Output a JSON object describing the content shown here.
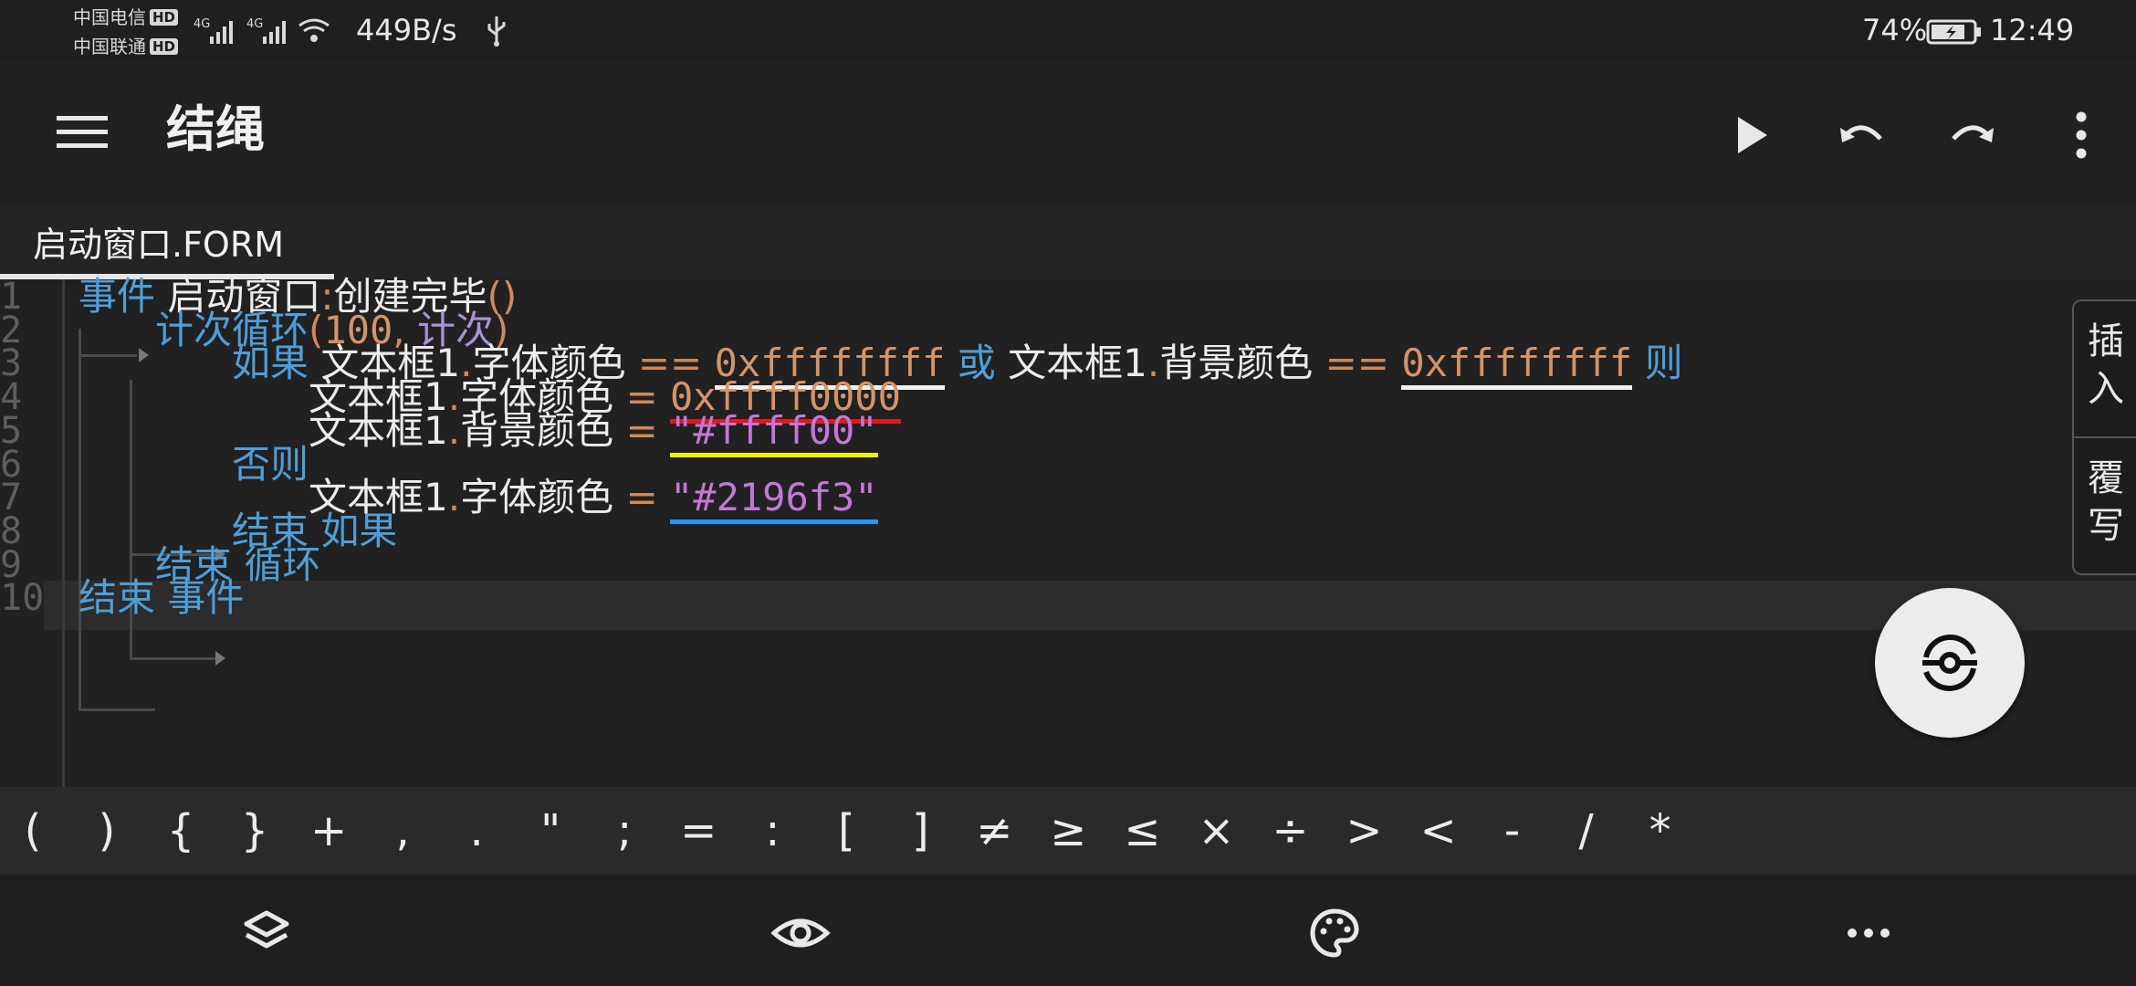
{
  "status_bar": {
    "carrier1": "中国电信",
    "carrier2": "中国联通",
    "hd": "HD",
    "net_type": "4G",
    "net_speed": "449B/s",
    "battery": "74%",
    "time": "12:49"
  },
  "app_bar": {
    "title": "结绳",
    "actions": [
      "menu-icon",
      "play-icon",
      "undo-icon",
      "redo-icon",
      "more-vert-icon"
    ]
  },
  "tabs": [
    {
      "label": "启动窗口.FORM",
      "active": true
    }
  ],
  "editor": {
    "current_line": 7,
    "lines": [
      {
        "num": "1",
        "tokens": [
          {
            "t": "事件",
            "c": "kw"
          },
          {
            "t": " 启动窗口",
            "c": "id"
          },
          {
            "t": ":",
            "c": "op"
          },
          {
            "t": "创建完毕",
            "c": "id"
          },
          {
            "t": "()",
            "c": "op"
          }
        ]
      },
      {
        "num": "2",
        "tokens": [
          {
            "t": "计次循环",
            "c": "kw"
          },
          {
            "t": "(",
            "c": "op"
          },
          {
            "t": "100",
            "c": "num"
          },
          {
            "t": ", ",
            "c": "op"
          },
          {
            "t": "计次",
            "c": "call"
          },
          {
            "t": ")",
            "c": "op"
          }
        ]
      },
      {
        "num": "3",
        "tokens": [
          {
            "t": "如果",
            "c": "kw"
          },
          {
            "t": " 文本框1",
            "c": "id"
          },
          {
            "t": ".",
            "c": "op"
          },
          {
            "t": "字体颜色",
            "c": "id"
          },
          {
            "t": " == ",
            "c": "op"
          },
          {
            "t": "0xffffffff",
            "c": "num",
            "u": "#f0f0f0"
          },
          {
            "t": " 或",
            "c": "kw"
          },
          {
            "t": " 文本框1",
            "c": "id"
          },
          {
            "t": ".",
            "c": "op"
          },
          {
            "t": "背景颜色",
            "c": "id"
          },
          {
            "t": " == ",
            "c": "op"
          },
          {
            "t": "0xffffffff",
            "c": "num",
            "u": "#f0f0f0"
          },
          {
            "t": " 则",
            "c": "kw"
          }
        ]
      },
      {
        "num": "4",
        "tokens": [
          {
            "t": "文本框1",
            "c": "id"
          },
          {
            "t": ".",
            "c": "op"
          },
          {
            "t": "字体颜色",
            "c": "id"
          },
          {
            "t": " = ",
            "c": "op"
          },
          {
            "t": "0xffff0000",
            "c": "num",
            "u": "#e0181d"
          }
        ]
      },
      {
        "num": "5",
        "tokens": [
          {
            "t": "文本框1",
            "c": "id"
          },
          {
            "t": ".",
            "c": "op"
          },
          {
            "t": "背景颜色",
            "c": "id"
          },
          {
            "t": " = ",
            "c": "op"
          },
          {
            "t": "\"#ffff00\"",
            "c": "str",
            "u": "#f5f000"
          }
        ]
      },
      {
        "num": "6",
        "tokens": [
          {
            "t": "否则",
            "c": "kw"
          }
        ]
      },
      {
        "num": "7",
        "tokens": [
          {
            "t": "文本框1",
            "c": "id"
          },
          {
            "t": ".",
            "c": "op"
          },
          {
            "t": "字体颜色",
            "c": "id"
          },
          {
            "t": " = ",
            "c": "op"
          },
          {
            "t": "\"#2196f3\"",
            "c": "str",
            "u": "#2196f3"
          }
        ]
      },
      {
        "num": "8",
        "tokens": [
          {
            "t": "结束 如果",
            "c": "kw"
          }
        ]
      },
      {
        "num": "9",
        "tokens": [
          {
            "t": "结束 循环",
            "c": "kw"
          }
        ]
      },
      {
        "num": "10",
        "tokens": [
          {
            "t": "结束 事件",
            "c": "kw"
          }
        ]
      }
    ]
  },
  "side_buttons": {
    "insert": "插入",
    "overwrite": "覆写"
  },
  "fab_icon": "code-tool-icon",
  "symbols": [
    "(",
    ")",
    "{",
    "}",
    "+",
    ",",
    ".",
    "\"",
    ";",
    "=",
    ":",
    "[",
    "]",
    "≠",
    "≥",
    "≤",
    "×",
    "÷",
    ">",
    "<",
    "-",
    "/",
    "*"
  ],
  "bottom_nav": [
    "layers-icon",
    "eye-icon",
    "palette-icon",
    "more-horiz-icon"
  ]
}
